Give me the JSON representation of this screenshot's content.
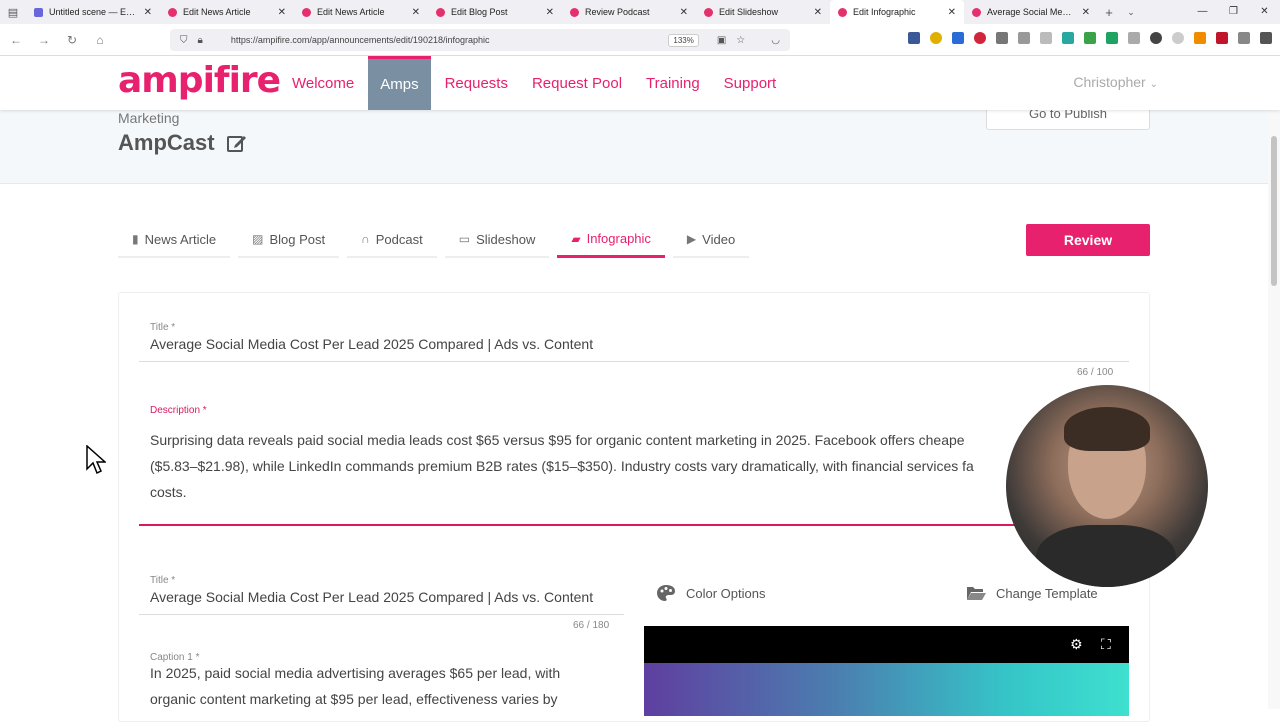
{
  "browser": {
    "tabs": [
      {
        "title": "Untitled scene — Excalidraw",
        "active": false
      },
      {
        "title": "Edit News Article",
        "active": false
      },
      {
        "title": "Edit News Article",
        "active": false
      },
      {
        "title": "Edit Blog Post",
        "active": false
      },
      {
        "title": "Review Podcast",
        "active": false
      },
      {
        "title": "Edit Slideshow",
        "active": false
      },
      {
        "title": "Edit Infographic",
        "active": true
      },
      {
        "title": "Average Social Media Cost",
        "active": false
      }
    ],
    "url": "https://ampifire.com/app/announcements/edit/190218/infographic",
    "zoom": "133%"
  },
  "header": {
    "logo": "ampifire",
    "nav": [
      {
        "label": "Welcome",
        "active": false
      },
      {
        "label": "Amps",
        "active": true
      },
      {
        "label": "Requests",
        "active": false
      },
      {
        "label": "Request Pool",
        "active": false
      },
      {
        "label": "Training",
        "active": false
      },
      {
        "label": "Support",
        "active": false
      }
    ],
    "user": "Christopher"
  },
  "subheader": {
    "category": "Marketing",
    "title": "AmpCast",
    "publish_label": "Go to Publish"
  },
  "content_tabs": [
    {
      "label": "News Article",
      "icon": "document-icon",
      "active": false
    },
    {
      "label": "Blog Post",
      "icon": "pencil-square-icon",
      "active": false
    },
    {
      "label": "Podcast",
      "icon": "headphones-icon",
      "active": false
    },
    {
      "label": "Slideshow",
      "icon": "monitor-icon",
      "active": false
    },
    {
      "label": "Infographic",
      "icon": "image-file-icon",
      "active": true
    },
    {
      "label": "Video",
      "icon": "play-circle-icon",
      "active": false
    }
  ],
  "review_label": "Review",
  "form": {
    "title_label": "Title *",
    "title_value": "Average Social Media Cost Per Lead 2025 Compared | Ads vs. Content",
    "title_counter": "66 / 100",
    "description_label": "Description *",
    "description_line1": "Surprising data reveals paid social media leads cost $65 versus $95 for organic content marketing in 2025. Facebook offers cheape",
    "description_line2": "($5.83–$21.98), while LinkedIn commands premium B2B rates ($15–$350). Industry costs vary dramatically, with financial services fa",
    "description_line3": "costs.",
    "infographic_title_label": "Title *",
    "infographic_title_value": "Average Social Media Cost Per Lead 2025 Compared | Ads vs. Content",
    "infographic_title_counter": "66 / 180",
    "caption_label": "Caption 1 *",
    "caption_line1": "In 2025, paid social media advertising averages $65 per lead, with",
    "caption_line2": "organic content marketing at $95 per lead, effectiveness varies by"
  },
  "options": {
    "color_label": "Color Options",
    "template_label": "Change Template"
  },
  "colors": {
    "brand": "#e8216f",
    "nav_active_bg": "#7b8fa3"
  }
}
